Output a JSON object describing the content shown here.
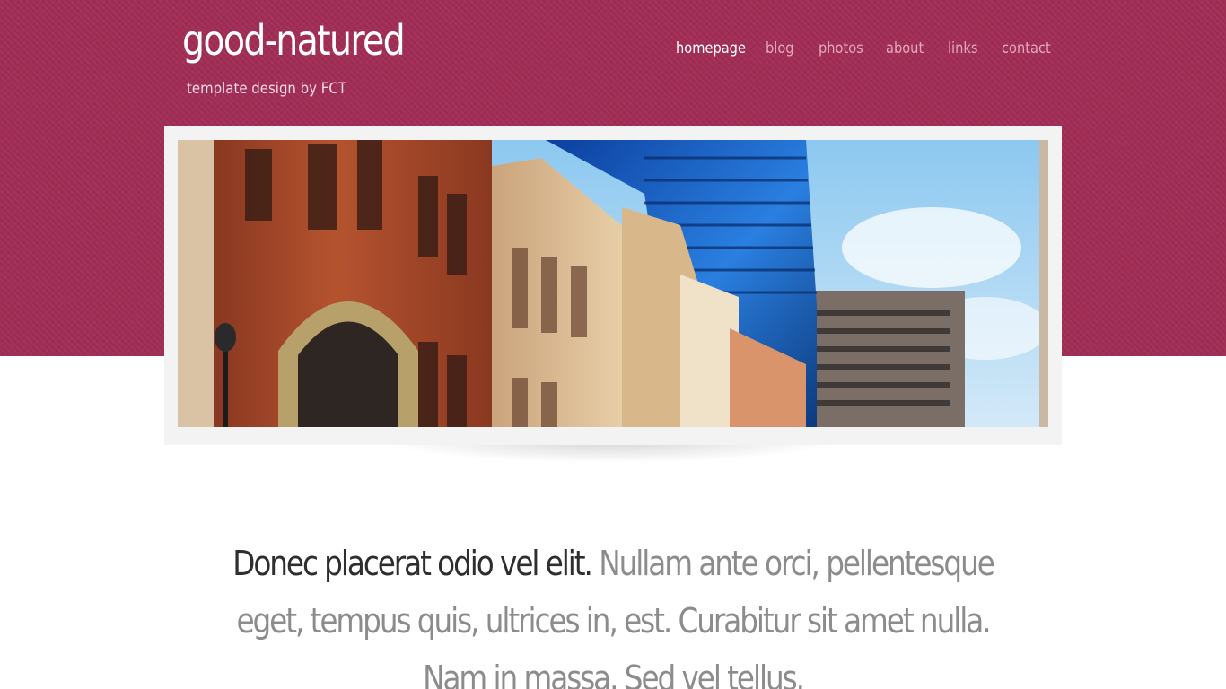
{
  "site": {
    "title": "good-natured",
    "tagline": "template design by FCT"
  },
  "nav": {
    "items": [
      {
        "label": "homepage",
        "active": true
      },
      {
        "label": "blog",
        "active": false
      },
      {
        "label": "photos",
        "active": false
      },
      {
        "label": "about",
        "active": false
      },
      {
        "label": "links",
        "active": false
      },
      {
        "label": "contact",
        "active": false
      }
    ]
  },
  "banner": {
    "image_subject": "city street buildings"
  },
  "intro": {
    "lead": "Donec placerat odio vel elit.",
    "body": "Nullam ante orci, pellentesque eget, tempus quis, ultrices in, est. Curabitur sit amet nulla. Nam in massa. Sed vel tellus."
  },
  "colors": {
    "header_background": "#a12d55",
    "nav_active": "#ffffff",
    "nav_inactive": "#e3a8bb",
    "lead_text": "#2e2e2e",
    "body_text": "#8c8c8c",
    "banner_frame": "#f3f3f3"
  }
}
